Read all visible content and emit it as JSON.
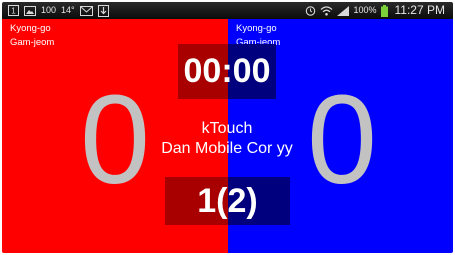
{
  "status_bar": {
    "notif_count": "100",
    "temperature": "14°",
    "battery_percent": "100%",
    "time": "11:27 PM",
    "icons": [
      "notification-1-icon",
      "image-icon",
      "mail-icon",
      "download-icon",
      "alarm-icon",
      "wifi-icon",
      "signal-icon",
      "battery-icon"
    ]
  },
  "red_player": {
    "penalty_1": "Kyong-go",
    "penalty_2": "Gam-jeom",
    "score": "0",
    "color": "#ff0000"
  },
  "blue_player": {
    "penalty_1": "Kyong-go",
    "penalty_2": "Gam-jeom",
    "score": "0",
    "color": "#0000ff"
  },
  "timer": "00:00",
  "center": {
    "line_1": "kTouch",
    "line_2": "Dan Mobile Cor yy"
  },
  "round": "1(2)"
}
